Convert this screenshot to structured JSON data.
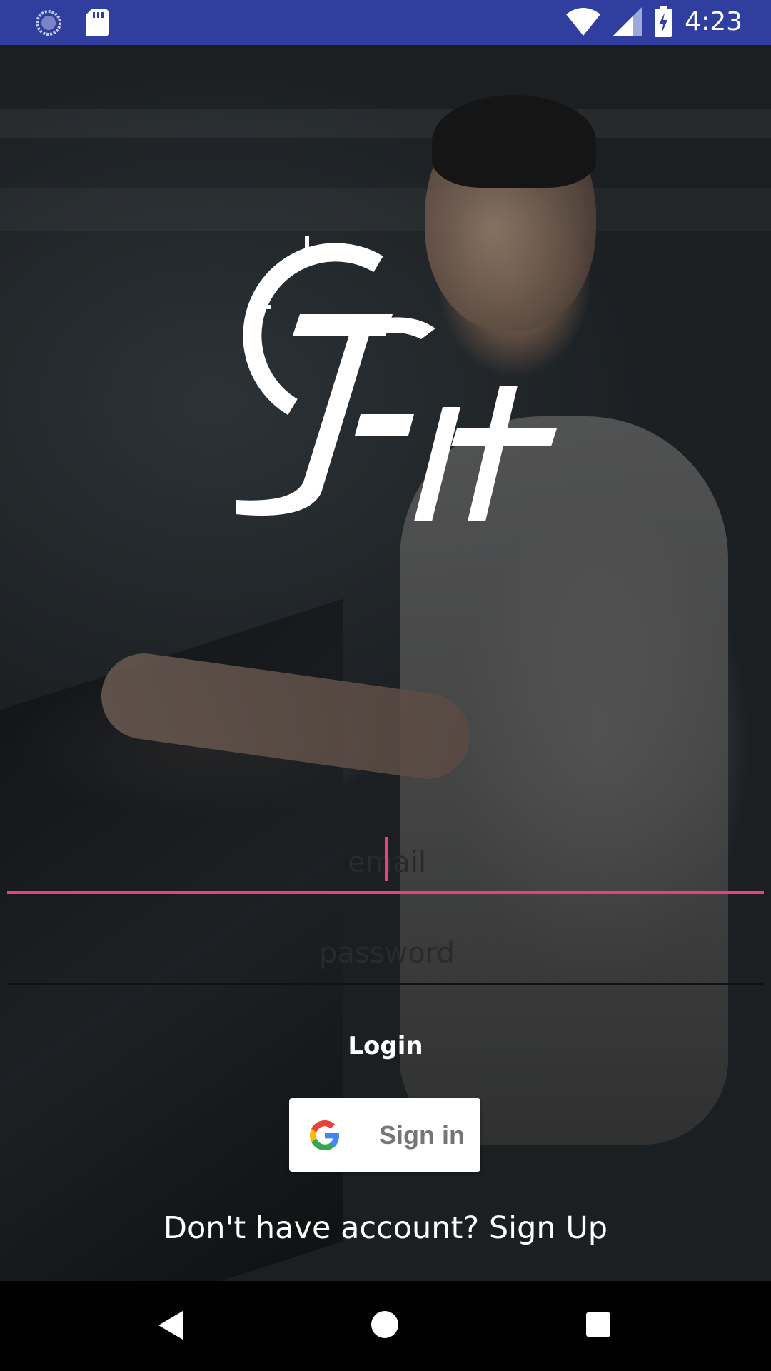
{
  "status_bar": {
    "time": "4:23",
    "left_icons": [
      "sync-icon",
      "sd-card-icon"
    ],
    "right_icons": [
      "wifi-icon",
      "signal-icon",
      "battery-charging-icon"
    ],
    "color": "#303f9f"
  },
  "logo": {
    "text": "GFit"
  },
  "login_form": {
    "email_placeholder": "email",
    "email_value": "",
    "password_placeholder": "password",
    "password_value": "",
    "login_label": "Login",
    "accent_color": "#ec407a"
  },
  "google_signin": {
    "label": "Sign in",
    "icon": "google-g-icon"
  },
  "signup": {
    "text": "Don't have account? Sign Up"
  },
  "nav_bar": {
    "icons": [
      "back-icon",
      "home-icon",
      "recents-icon"
    ]
  }
}
